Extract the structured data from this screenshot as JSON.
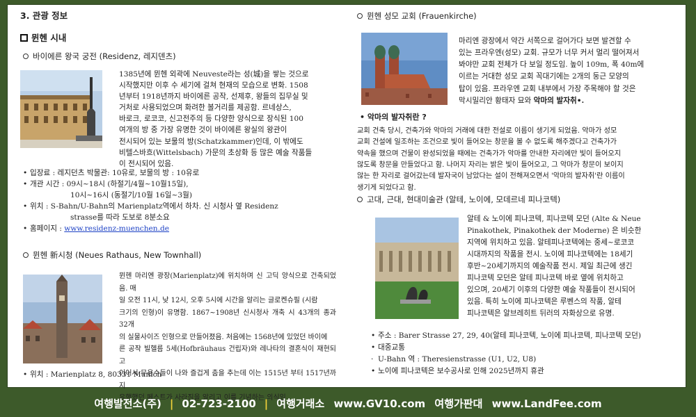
{
  "left": {
    "section_title": "3. 관광 정보",
    "subsection_title": "뮌헨 시내",
    "residenz": {
      "title": "바이에른 왕국 궁전 (Residenz, 레지덴츠)",
      "lines": [
        "1385년에 뮌헨 외곽에 Neuveste라는 성(城)을 쌓는 것으로",
        "시작했지만 이후 수 세기에 걸쳐 현재의 모습으로 변화. 1508",
        "년부터 1918년까지 바이에른 공작, 선제후, 왕들의 집무실 및",
        "거처로 사용되었으며 화려한 볼거리를 제공함. 르네상스,",
        "바로크, 로코코, 신고전주의 등 다양한 양식으로 장식된 100",
        "여개의 방 중 가장 유명한 것이 바이에른 왕실의 왕관이",
        "전시되어 있는 보물의 방(Schatzkammer)인데, 이 밖에도",
        "비텔스바흐(Wittelsbach) 가문의 초상화 등 많은 예술 작품들",
        "이 전시되어 있음."
      ],
      "admission": "입장료 : 레지던츠 박물관: 10유로, 보물의 방 : 10유로",
      "hours_1": "개관 시간 : 09시~18시 (하절기/4월~10월15일),",
      "hours_2": "10시~16시 (동절기/10월 16일~3월)",
      "location_1": "위치 : S-Bahn/U-Bahn의 Marienplatz역에서 하차. 신 시청사 옆 Residenz",
      "location_2": "strasse를 따라 도보로 8분소요",
      "homepage_label": "홈페이지 : ",
      "homepage_url": "www.residenz-muenchen.de"
    },
    "rathaus": {
      "title": "뮌헨 新시청 (Neues Rathaus, New Townhall)",
      "lines": [
        "뮌헨 마리엔 광장(Marienplatz)에 위치하며 신 고딕 양식으로 건축되었음. 매",
        "일 오전 11시, 낮 12시, 오후 5시에 시간을 알리는 글로켄슈필       (시람",
        "크기의 인형)이 유명함. 1867~1908년 신시청사 개축 시 43개의 종과 32개",
        "의 실물사이즈 인형으로 만들어졌음. 처음에는 1568년에      있었던 바이에",
        "른 공작 빌헬름 5세(Hofbräuhaus 건립자)와 레나타의 결혼식이 재현되고",
        "이어서 무용수들이 나와  즐겁게 춤을 추는데 이는 1515년 부터 1517년까지",
        "유행했던 페스트가 사라짐을 알리고 이를 기념하는 의식임"
      ],
      "location": "위치 : Marienplatz 8, 80331 Munich"
    }
  },
  "right": {
    "frauenkirche": {
      "title": "뮌헨 성모 교회 (Frauenkirche)",
      "lines": [
        "마리엔 광장에서 약간 서쪽으로 걸어가다 보면 발견할 수",
        "있는 프라우엔(성모) 교회. 규모가 너무 커서 멀리 떨어져서",
        "봐야만 교회 전체가 다 보일 정도임. 높이 109m, 폭 40m에",
        "이르는 거대한 성모 교회 꼭대기에는 2개의 둥근 모양의",
        "탑이 있음. 프라우엔 교회 내부에서 가장 주목해야 할 것은",
        "막시밀리안 황태자 묘와 "
      ],
      "last_bold": "악마의 발자취•.",
      "devil_title": "악마의 발자취란 ?",
      "devil_lines": [
        "교회 건축 당시, 건축가와 악마의 거래에 대한 전설로 이름이 생기게 되었음.  악마가 성모",
        "교회 건설에 일조하는 조건으로 빛이 들어오는 창문을 볼 수 없도록 해주겠다고 건축가가",
        "약속을 했으며 건물이 완성되었을 때에는 건축가가 악마를 안내한 자리에만 빛이 들어오지",
        "않도록 창문을 만들었다고 함. 나머지 자리는 밝은 빛이 들어오고, 그 악마가 창문이 보이지",
        "않는 한 자리로 걸어갔는데 발자국이 남았다는 설이 전해져오면서 '악마의 발자취'란 이름이",
        "생기게 되었다고 함."
      ]
    },
    "pinakothek": {
      "title": "고대, 근대, 현대미술관 (알테, 노이에, 모데르네 피나코텍)",
      "lines": [
        "알테 & 노이에 피나코텍, 피나코텍 모던 (Alte & Neue",
        "Pinakothek, Pinakothek der Moderne) 은 비슷한",
        "지역에 위치하고 있음. 알테피나코텍에는 중세~로코코",
        "시대까지의 작품을 전시. 노이에 피나코텍에는 18세기",
        "후반~20세기까지의 예술작품 전시. 제일 최근에 생긴",
        "피나코텍 모던은 알테 피나코텍 바로 옆에 위치하고",
        "있으며, 20세기 이후의 다양한 예술 작품들이 전시되어",
        "있음. 특히 노이에 피나코텍은 루벤스의 작품, 알테",
        "피나코텍은 알브레히트 뒤러의 자화상으로 유명."
      ],
      "address": "주소 : Barer Strasse 27, 29, 40(알테 피나코텍, 노이에 피나코텍, 피나코텍 모던)",
      "transport": "대중교통",
      "ubahn": "U-Bahn 역 : Theresienstrasse (U1, U2, U8)",
      "closure": "노이에 피나코텍은 보수공사로 인해 2025년까지 휴관"
    }
  },
  "footer": {
    "company": "여행발전소(주)",
    "phone": "02-723-2100",
    "exchange": "여행거래소",
    "site1": "www.GV10.com",
    "market": "여행가판대",
    "site2": "www.LandFee.com"
  },
  "colors": {
    "background": "#3d5a2a",
    "footer_separator": "#f1d23a",
    "link": "#1a3fc4"
  }
}
